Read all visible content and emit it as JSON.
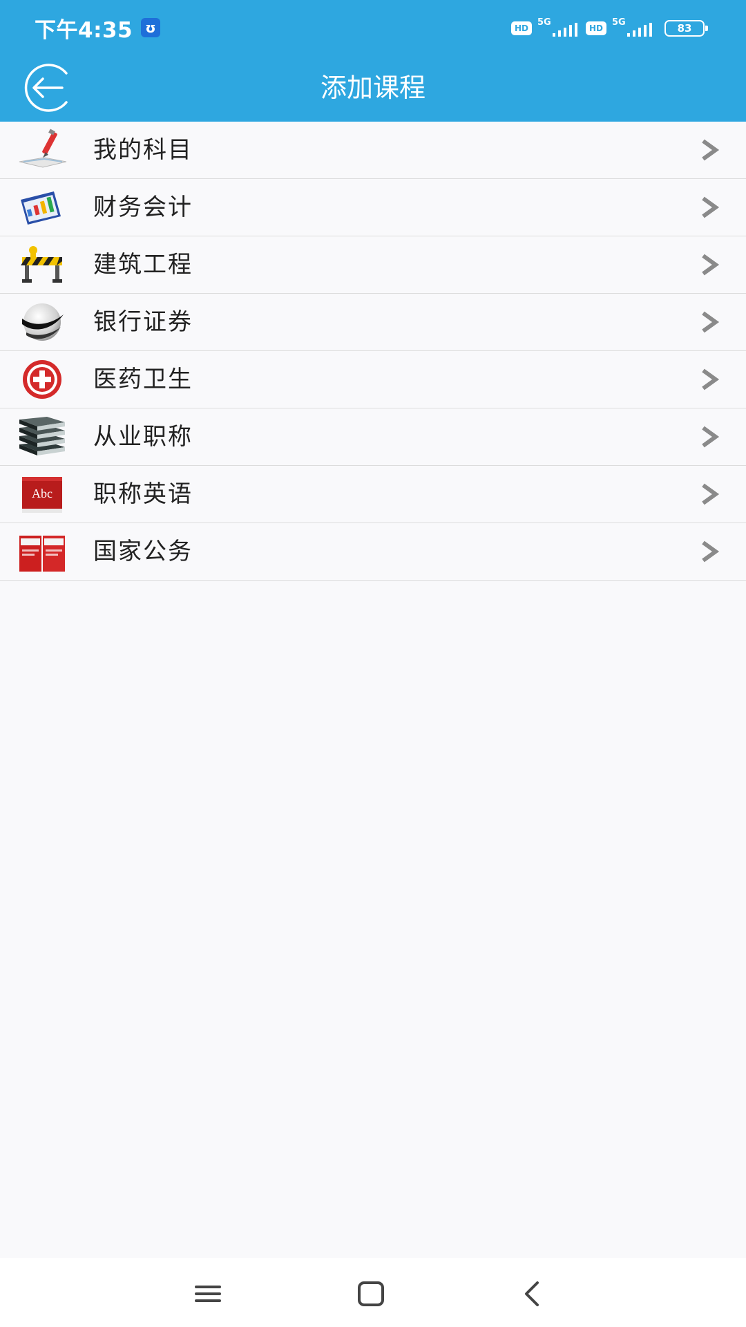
{
  "status_bar": {
    "time": "下午4:35",
    "app_icon_glyph": "ʊ",
    "hd_label": "HD",
    "network_label_1": "5G",
    "network_label_2": "5G",
    "battery": "83"
  },
  "header": {
    "title": "添加课程",
    "back_icon": "back-arrow-circle-icon"
  },
  "colors": {
    "primary": "#2ea7e0",
    "background": "#f9f9fb",
    "divider": "#dcdcdc",
    "text": "#222222",
    "chevron": "#8a8a8a"
  },
  "list": {
    "items": [
      {
        "label": "我的科目",
        "icon": "pen-notebook-icon"
      },
      {
        "label": "财务会计",
        "icon": "finance-chart-icon"
      },
      {
        "label": "建筑工程",
        "icon": "construction-barrier-icon"
      },
      {
        "label": "银行证券",
        "icon": "swoosh-globe-icon"
      },
      {
        "label": "医药卫生",
        "icon": "medical-cross-icon"
      },
      {
        "label": "从业职称",
        "icon": "book-stack-icon"
      },
      {
        "label": "职称英语",
        "icon": "abc-book-icon",
        "icon_text": "Abc"
      },
      {
        "label": "国家公务",
        "icon": "red-books-icon"
      }
    ]
  },
  "nav_bar": {
    "menu_icon": "menu-icon",
    "home_icon": "home-icon",
    "back_icon": "back-icon"
  }
}
